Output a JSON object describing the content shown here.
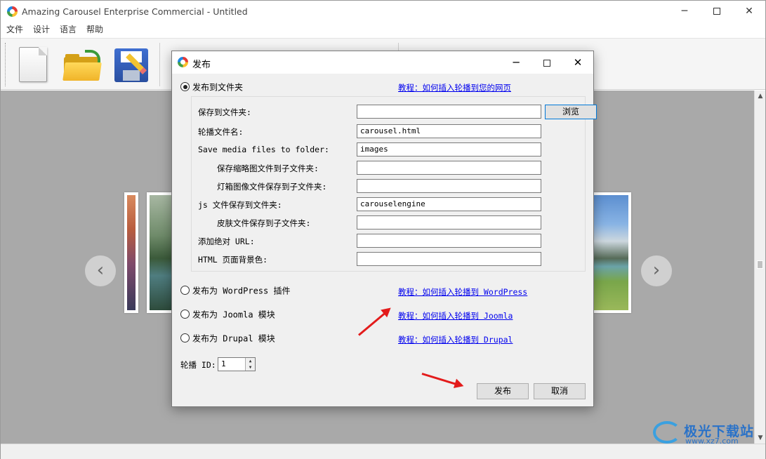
{
  "app": {
    "title": "Amazing Carousel Enterprise Commercial - Untitled",
    "window_controls": {
      "minimize": "─",
      "maximize": "",
      "close": "✕"
    }
  },
  "menu": [
    "文件",
    "设计",
    "语言",
    "帮助"
  ],
  "toolbar": {
    "buttons": [
      "new-document-icon",
      "open-folder-icon",
      "save-disk-icon"
    ]
  },
  "carousel": {
    "prev": "‹",
    "next": "›"
  },
  "dialog": {
    "title": "发布",
    "controls": {
      "minimize": "─",
      "maximize": "",
      "close": "✕"
    },
    "options": {
      "folder": {
        "label": "发布到文件夹",
        "link": "教程：如何插入轮播到您的网页",
        "selected": true
      },
      "wordpress": {
        "label": "发布为 WordPress 插件",
        "link": "教程：如何插入轮播到 WordPress",
        "selected": false
      },
      "joomla": {
        "label": "发布为 Joomla 模块",
        "link": "教程：如何插入轮播到 Joomla",
        "selected": false
      },
      "drupal": {
        "label": "发布为 Drupal 模块",
        "link": "教程：如何插入轮播到 Drupal",
        "selected": false
      }
    },
    "fields": [
      {
        "label": "保存到文件夹:",
        "value": ""
      },
      {
        "label": "轮播文件名:",
        "value": "carousel.html"
      },
      {
        "label": "Save media files to folder:",
        "value": "images"
      },
      {
        "label": "保存缩略图文件到子文件夹:",
        "value": ""
      },
      {
        "label": "灯箱图像文件保存到子文件夹:",
        "value": ""
      },
      {
        "label": "js 文件保存到文件夹:",
        "value": "carouselengine"
      },
      {
        "label": "皮肤文件保存到子文件夹:",
        "value": ""
      },
      {
        "label": "添加绝对 URL:",
        "value": ""
      },
      {
        "label": "HTML 页面背景色:",
        "value": ""
      }
    ],
    "browse_label": "浏览",
    "carousel_id_label": "轮播 ID:",
    "carousel_id_value": "1",
    "publish_label": "发布",
    "cancel_label": "取消"
  },
  "watermark": {
    "name": "极光下载站",
    "url": "www.xz7.com"
  }
}
